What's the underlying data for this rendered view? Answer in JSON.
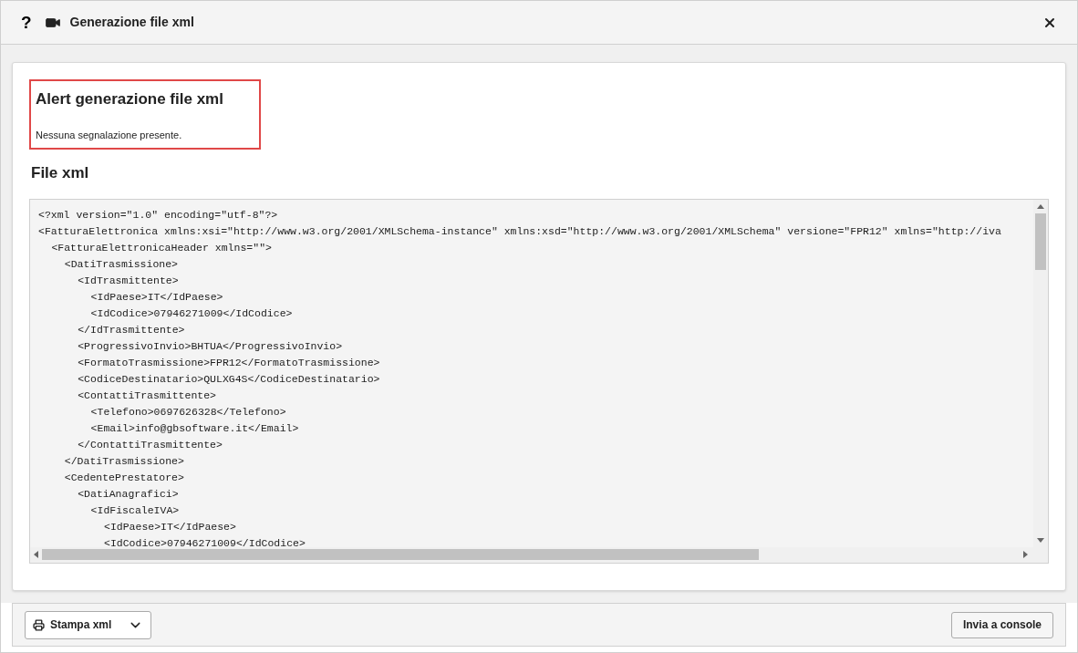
{
  "dialog": {
    "title": "Generazione file xml",
    "help_icon": "?"
  },
  "alert": {
    "title": "Alert generazione file xml",
    "message": "Nessuna segnalazione presente."
  },
  "xml_section": {
    "title": "File xml",
    "lines": [
      {
        "text": "<?xml version=\"1.0\" encoding=\"utf-8\"?>"
      },
      {
        "text": "<FatturaElettronica xmlns:xsi=\"http://www.w3.org/2001/XMLSchema-instance\" xmlns:xsd=\"http://www.w3.org/2001/XMLSchema\" versione=\"FPR12\" xmlns=\"http://iva",
        "children": [
          {
            "text": "<FatturaElettronicaHeader xmlns=\"\">",
            "children": [
              {
                "text": "<DatiTrasmissione>",
                "children": [
                  {
                    "text": "<IdTrasmittente>",
                    "children": [
                      {
                        "text": "<IdPaese>IT</IdPaese>"
                      },
                      {
                        "text": "<IdCodice>07946271009</IdCodice>"
                      }
                    ]
                  },
                  {
                    "text": "</IdTrasmittente>"
                  },
                  {
                    "text": "<ProgressivoInvio>BHTUA</ProgressivoInvio>"
                  },
                  {
                    "text": "<FormatoTrasmissione>FPR12</FormatoTrasmissione>"
                  },
                  {
                    "text": "<CodiceDestinatario>QULXG4S</CodiceDestinatario>"
                  },
                  {
                    "text": "<ContattiTrasmittente>",
                    "children": [
                      {
                        "text": "<Telefono>0697626328</Telefono>"
                      },
                      {
                        "text": "<Email>info@gbsoftware.it</Email>"
                      }
                    ]
                  },
                  {
                    "text": "</ContattiTrasmittente>"
                  }
                ]
              },
              {
                "text": "</DatiTrasmissione>"
              },
              {
                "text": "<CedentePrestatore>",
                "children": [
                  {
                    "text": "<DatiAnagrafici>",
                    "children": [
                      {
                        "text": "<IdFiscaleIVA>",
                        "children": [
                          {
                            "text": "<IdPaese>IT</IdPaese>"
                          },
                          {
                            "text": "<IdCodice>07946271009</IdCodice>"
                          }
                        ]
                      }
                    ]
                  }
                ]
              }
            ]
          }
        ]
      }
    ]
  },
  "footer": {
    "print_button": "Stampa xml",
    "send_button": "Invia a console"
  }
}
